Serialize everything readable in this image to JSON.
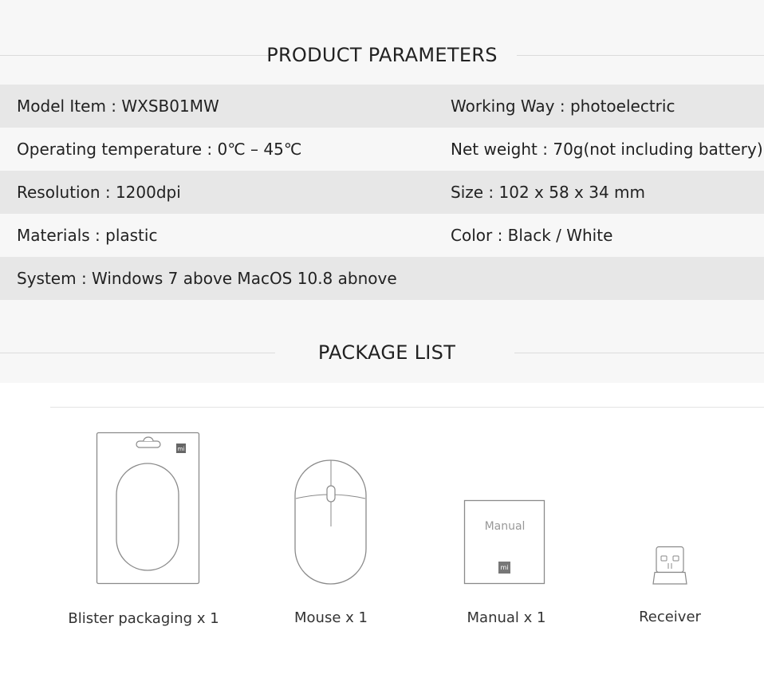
{
  "product_parameters": {
    "title": "PRODUCT PARAMETERS",
    "rows": [
      {
        "left": "Model Item : WXSB01MW",
        "right": "Working Way : photoelectric"
      },
      {
        "left": "Operating temperature  :  0℃ – 45℃",
        "right": "Net weight  :  70g(not including battery)"
      },
      {
        "left": "Resolution  : 1200dpi",
        "right": "Size  : 102 x 58 x 34 mm"
      },
      {
        "left": "Materials  : plastic",
        "right": "Color  : Black / White"
      },
      {
        "left": "System : Windows 7 above MacOS 10.8 abnove",
        "right": ""
      }
    ]
  },
  "package_list": {
    "title": "PACKAGE LIST",
    "items": [
      {
        "label": "Blister packaging x 1",
        "icon": "blister-pack-icon"
      },
      {
        "label": "Mouse x 1",
        "icon": "mouse-icon"
      },
      {
        "label": "Manual x 1",
        "icon": "manual-icon",
        "inner_text": "Manual",
        "logo": "mi"
      },
      {
        "label": "Receiver",
        "icon": "usb-receiver-icon"
      }
    ],
    "blister_logo": "mi"
  }
}
